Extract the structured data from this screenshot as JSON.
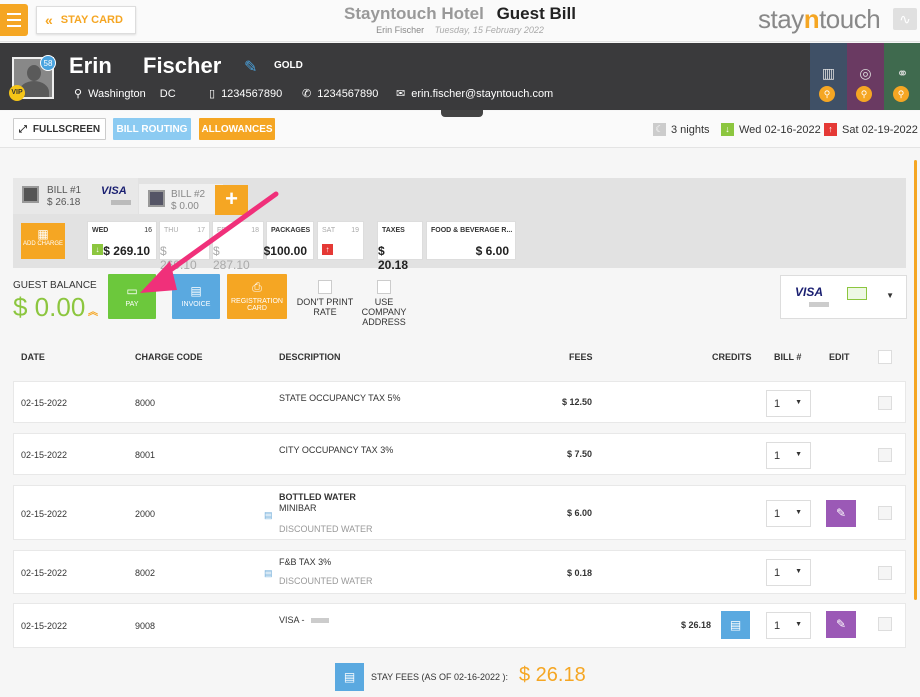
{
  "header": {
    "stay_card_label": "STAY CARD",
    "hotel_name": "Stayntouch Hotel",
    "page_title": "Guest Bill",
    "guest_name_sub": "Erin Fischer",
    "date_sub": "Tuesday, 15 February 2022",
    "logo_pre": "stay",
    "logo_mid": "n",
    "logo_post": "touch"
  },
  "guest": {
    "first_name": "Erin",
    "last_name": "Fischer",
    "loyalty": "GOLD",
    "vip": "VIP",
    "badge_count": "58",
    "city": "Washington",
    "state": "DC",
    "phone1": "1234567890",
    "phone2": "1234567890",
    "email": "erin.fischer@stayntouch.com"
  },
  "toolbar": {
    "fullscreen": "FULLSCREEN",
    "bill_routing": "BILL ROUTING",
    "allowances": "ALLOWANCES",
    "nights": "3 nights",
    "arrival": "Wed 02-16-2022",
    "departure": "Sat 02-19-2022"
  },
  "bills": {
    "bill1_label": "BILL #1",
    "bill1_amount": "$ 26.18",
    "bill1_card": "VISA",
    "bill2_label": "BILL #2",
    "bill2_amount": "$ 0.00",
    "add_label": "+"
  },
  "add_charge": "ADD CHARGE",
  "days": [
    {
      "day": "WED",
      "num": "16",
      "value": "$ 269.10"
    },
    {
      "day": "THU",
      "num": "17",
      "value": "$ 269.10"
    },
    {
      "day": "FRI",
      "num": "18",
      "value": "$ 287.10"
    },
    {
      "day": "PACKAGES",
      "num": "",
      "value": "$100.00"
    },
    {
      "day": "SAT",
      "num": "19",
      "value": ""
    },
    {
      "day": "TAXES",
      "num": "",
      "value": "$ 20.18"
    },
    {
      "day": "FOOD & BEVERAGE R...",
      "num": "",
      "value": "$ 6.00"
    }
  ],
  "balance": {
    "label": "GUEST BALANCE",
    "amount": "$ 0.00"
  },
  "actions": {
    "pay": "PAY",
    "invoice": "INVOICE",
    "registration_card": "REGISTRATION CARD",
    "dont_print_rate": "DON'T PRINT RATE",
    "use_company_address": "USE COMPANY ADDRESS",
    "card": "VISA"
  },
  "table": {
    "headers": [
      "DATE",
      "CHARGE CODE",
      "DESCRIPTION",
      "FEES",
      "CREDITS",
      "BILL #",
      "EDIT"
    ],
    "rows": [
      {
        "date": "02-15-2022",
        "code": "8000",
        "desc": "STATE OCCUPANCY TAX 5%",
        "desc2": "",
        "desc3": "",
        "fees": "$ 12.50",
        "credits": "",
        "bill": "1"
      },
      {
        "date": "02-15-2022",
        "code": "8001",
        "desc": "CITY OCCUPANCY TAX 3%",
        "desc2": "",
        "desc3": "",
        "fees": "$ 7.50",
        "credits": "",
        "bill": "1"
      },
      {
        "date": "02-15-2022",
        "code": "2000",
        "desc": "BOTTLED WATER",
        "desc2": "MINIBAR",
        "desc3": "DISCOUNTED WATER",
        "fees": "$ 6.00",
        "credits": "",
        "bill": "1"
      },
      {
        "date": "02-15-2022",
        "code": "8002",
        "desc": "F&B TAX 3%",
        "desc2": "",
        "desc3": "DISCOUNTED WATER",
        "fees": "$ 0.18",
        "credits": "",
        "bill": "1"
      },
      {
        "date": "02-15-2022",
        "code": "9008",
        "desc": "VISA - ",
        "desc2": "",
        "desc3": "",
        "fees": "",
        "credits": "$ 26.18",
        "bill": "1"
      }
    ]
  },
  "footer": {
    "label": "STAY FEES (AS OF 02-16-2022 ):",
    "value": "$ 26.18"
  },
  "colors": {
    "accent": "#f5a623",
    "green": "#8cc63f",
    "blue": "#5aa9e0",
    "purple": "#9b59b6",
    "arrow": "#f0307a"
  }
}
